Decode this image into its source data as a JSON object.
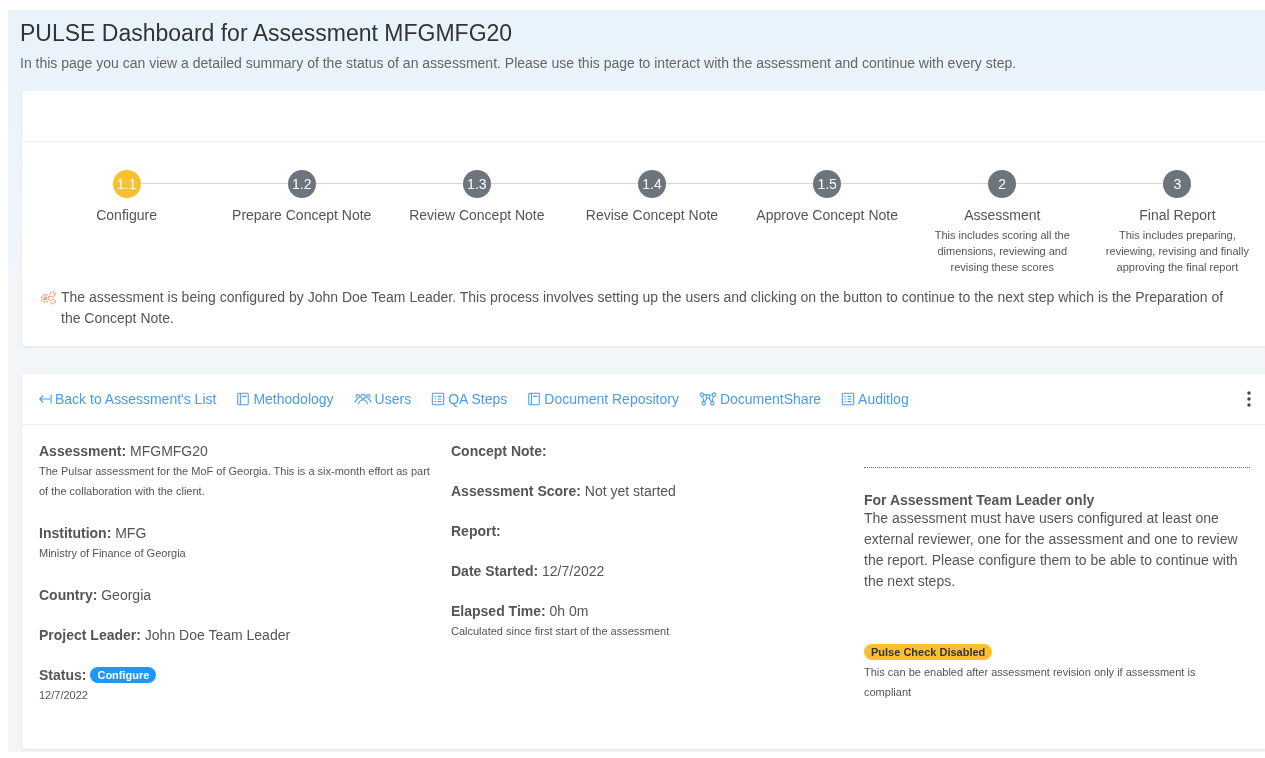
{
  "header": {
    "title": "PULSE Dashboard for Assessment MFGMFG20",
    "subtitle": "In this page you can view a detailed summary of the status of an assessment. Please use this page to interact with the assessment and continue with every step."
  },
  "steps": [
    {
      "number": "1.1",
      "label": "Configure",
      "current": true
    },
    {
      "number": "1.2",
      "label": "Prepare Concept Note",
      "current": false
    },
    {
      "number": "1.3",
      "label": "Review Concept Note",
      "current": false
    },
    {
      "number": "1.4",
      "label": "Revise Concept Note",
      "current": false
    },
    {
      "number": "1.5",
      "label": "Approve Concept Note",
      "current": false
    },
    {
      "number": "2",
      "label": "Assessment",
      "description": "This includes scoring all the dimensions, reviewing and revising these scores",
      "current": false
    },
    {
      "number": "3",
      "label": "Final Report",
      "description": "This includes preparing, reviewing, revising and finally approving the final report",
      "current": false
    }
  ],
  "step_message": "The assessment is being configured by John Doe Team Leader. This process involves setting up the users and clicking on the button to continue to the next step which is the Preparation of the Concept Note.",
  "nav": [
    {
      "label": "Back to Assessment's List",
      "kind": "back"
    },
    {
      "label": "Methodology",
      "kind": "book"
    },
    {
      "label": "Users",
      "kind": "users"
    },
    {
      "label": "QA Steps",
      "kind": "list"
    },
    {
      "label": "Document Repository",
      "kind": "book"
    },
    {
      "label": "DocumentShare",
      "kind": "share"
    },
    {
      "label": "Auditlog",
      "kind": "list"
    }
  ],
  "details_left": [
    {
      "label": "Assessment:",
      "value": "MFGMFG20",
      "note": "The Pulsar assessment for the MoF of Georgia. This is a six-month effort as part of the collaboration with the client."
    },
    {
      "label": "Institution:",
      "value": "MFG",
      "note": "Ministry of Finance of Georgia"
    },
    {
      "label": "Country:",
      "value": "Georgia"
    },
    {
      "label": "Project Leader:",
      "value": "John Doe Team Leader"
    },
    {
      "label": "Status:",
      "badge": "Configure",
      "note": "12/7/2022"
    }
  ],
  "details_middle": [
    {
      "label": "Concept Note:"
    },
    {
      "label": "Assessment Score:",
      "value": "Not yet started"
    },
    {
      "label": "Report:"
    },
    {
      "label": "Date Started:",
      "value": "12/7/2022"
    },
    {
      "label": "Elapsed Time:",
      "value": "0h 0m",
      "note": "Calculated since first start of the assessment"
    }
  ],
  "team_leader": {
    "heading": "For Assessment Team Leader only",
    "text": "The assessment must have users configured at least one external reviewer, one for the assessment and one to review the report. Please configure them to be able to continue with the next steps."
  },
  "pulse_check": {
    "badge": "Pulse Check Disabled",
    "note": "This can be enabled after assessment revision only if assessment is compliant"
  }
}
